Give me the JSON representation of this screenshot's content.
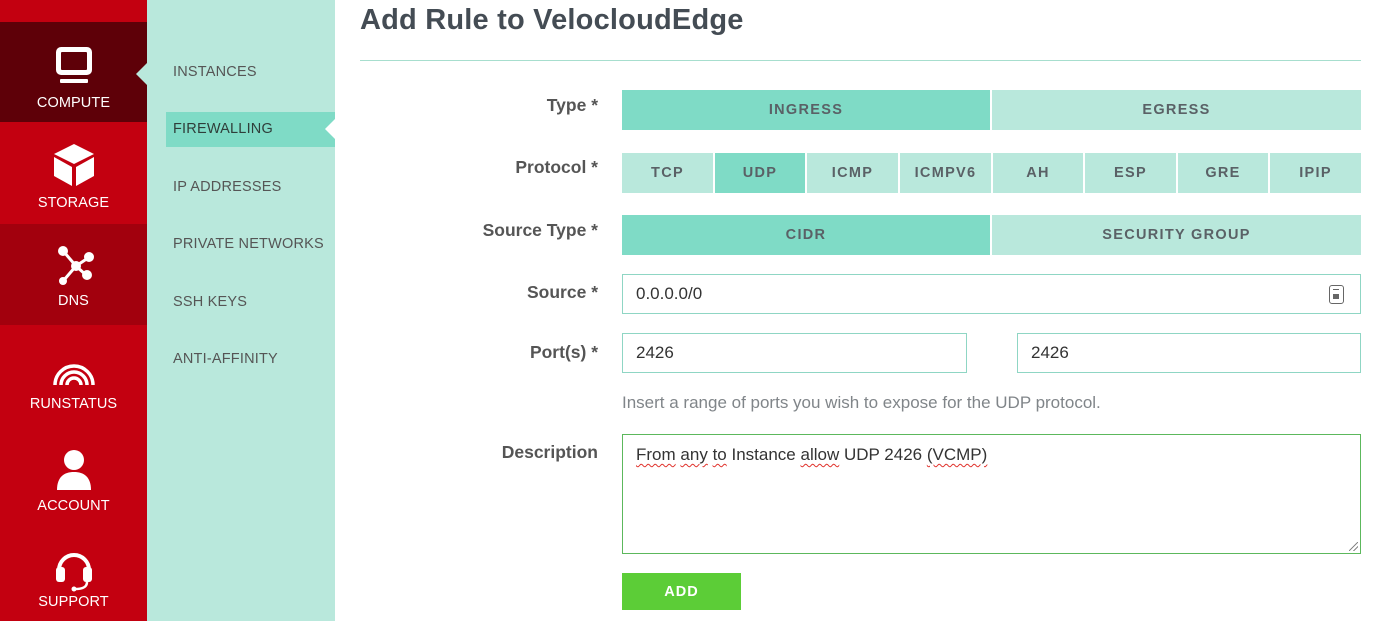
{
  "primary_nav": {
    "items": [
      {
        "label": "COMPUTE",
        "icon": "monitor-icon",
        "active": true
      },
      {
        "label": "STORAGE",
        "icon": "cube-icon"
      },
      {
        "label": "DNS",
        "icon": "share-nodes-icon"
      },
      {
        "label": "RUNSTATUS",
        "icon": "signal-icon"
      },
      {
        "label": "ACCOUNT",
        "icon": "user-icon"
      },
      {
        "label": "SUPPORT",
        "icon": "headset-icon"
      }
    ]
  },
  "secondary_nav": {
    "items": [
      {
        "label": "INSTANCES"
      },
      {
        "label": "FIREWALLING",
        "active": true
      },
      {
        "label": "IP ADDRESSES"
      },
      {
        "label": "PRIVATE NETWORKS"
      },
      {
        "label": "SSH KEYS"
      },
      {
        "label": "ANTI-AFFINITY"
      }
    ]
  },
  "main": {
    "title": "Add Rule to VelocloudEdge",
    "form": {
      "type": {
        "label": "Type *",
        "options": [
          "INGRESS",
          "EGRESS"
        ],
        "selected": "INGRESS"
      },
      "protocol": {
        "label": "Protocol *",
        "options": [
          "TCP",
          "UDP",
          "ICMP",
          "ICMPV6",
          "AH",
          "ESP",
          "GRE",
          "IPIP"
        ],
        "selected": "UDP"
      },
      "source_type": {
        "label": "Source Type *",
        "options": [
          "CIDR",
          "SECURITY GROUP"
        ],
        "selected": "CIDR"
      },
      "source": {
        "label": "Source *",
        "value": "0.0.0.0/0"
      },
      "ports": {
        "label": "Port(s) *",
        "start": "2426",
        "end": "2426",
        "help": "Insert a range of ports you wish to expose for the UDP protocol."
      },
      "description": {
        "label": "Description",
        "value": "From any to Instance allow UDP 2426 (VCMP)",
        "words": [
          "From",
          "any",
          "to",
          "Instance",
          "allow",
          "UDP",
          "2426",
          "(VCMP)"
        ]
      },
      "submit_label": "ADD"
    }
  },
  "colors": {
    "primary_nav_bg": "#c30010",
    "primary_nav_active": "#5e0008",
    "secondary_nav_bg": "#b9e8dc",
    "accent_teal": "#7fdbc6",
    "add_button": "#5ccd37"
  }
}
